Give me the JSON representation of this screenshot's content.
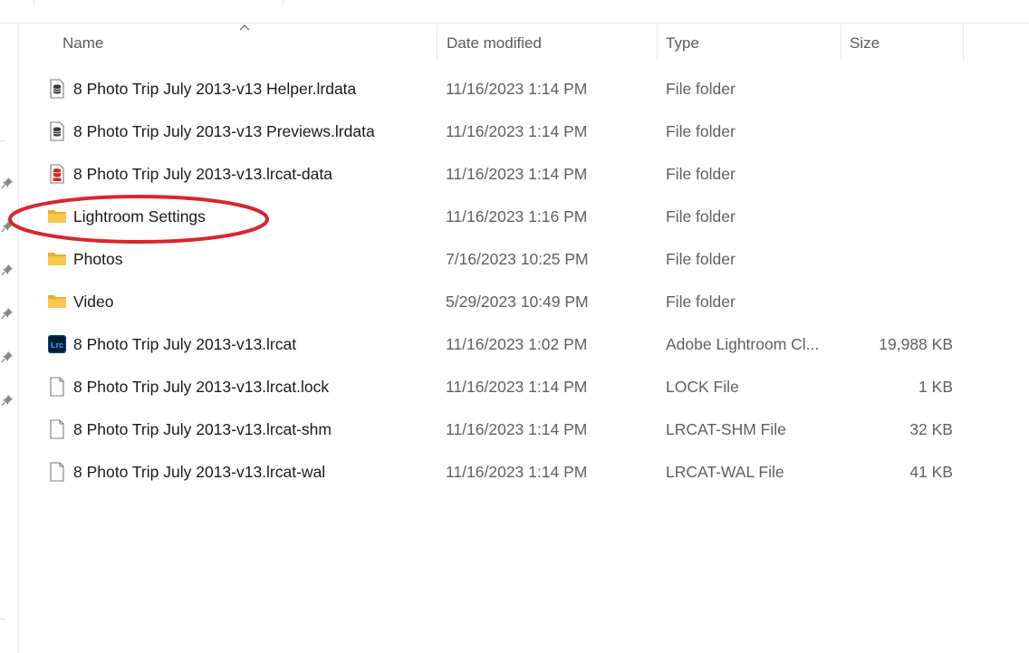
{
  "columns": {
    "name": "Name",
    "date_modified": "Date modified",
    "type": "Type",
    "size": "Size"
  },
  "sort": {
    "column": "name",
    "direction": "ascending",
    "icon": "chevron-up-icon"
  },
  "files": [
    {
      "name": "8 Photo Trip July 2013-v13 Helper.lrdata",
      "date": "11/16/2023 1:14 PM",
      "type": "File folder",
      "size": "",
      "icon": "lrdata-file-icon"
    },
    {
      "name": "8 Photo Trip July 2013-v13 Previews.lrdata",
      "date": "11/16/2023 1:14 PM",
      "type": "File folder",
      "size": "",
      "icon": "lrdata-file-icon"
    },
    {
      "name": "8 Photo Trip July 2013-v13.lrcat-data",
      "date": "11/16/2023 1:14 PM",
      "type": "File folder",
      "size": "",
      "icon": "lrcat-data-icon"
    },
    {
      "name": "Lightroom Settings",
      "date": "11/16/2023 1:16 PM",
      "type": "File folder",
      "size": "",
      "icon": "folder-icon"
    },
    {
      "name": "Photos",
      "date": "7/16/2023 10:25 PM",
      "type": "File folder",
      "size": "",
      "icon": "folder-icon"
    },
    {
      "name": "Video",
      "date": "5/29/2023 10:49 PM",
      "type": "File folder",
      "size": "",
      "icon": "folder-icon"
    },
    {
      "name": "8 Photo Trip July 2013-v13.lrcat",
      "date": "11/16/2023 1:02 PM",
      "type": "Adobe Lightroom Cl...",
      "size": "19,988 KB",
      "icon": "lightroom-catalog-icon"
    },
    {
      "name": "8 Photo Trip July 2013-v13.lrcat.lock",
      "date": "11/16/2023 1:14 PM",
      "type": "LOCK File",
      "size": "1 KB",
      "icon": "generic-file-icon"
    },
    {
      "name": "8 Photo Trip July 2013-v13.lrcat-shm",
      "date": "11/16/2023 1:14 PM",
      "type": "LRCAT-SHM File",
      "size": "32 KB",
      "icon": "generic-file-icon"
    },
    {
      "name": "8 Photo Trip July 2013-v13.lrcat-wal",
      "date": "11/16/2023 1:14 PM",
      "type": "LRCAT-WAL File",
      "size": "41 KB",
      "icon": "generic-file-icon"
    }
  ],
  "lightroom_badge": "Lrc",
  "colors": {
    "folder": "#f8c84a",
    "annotation": "#d9262b",
    "lightroom_bg": "#001e36",
    "lightroom_text": "#31a8ff"
  }
}
